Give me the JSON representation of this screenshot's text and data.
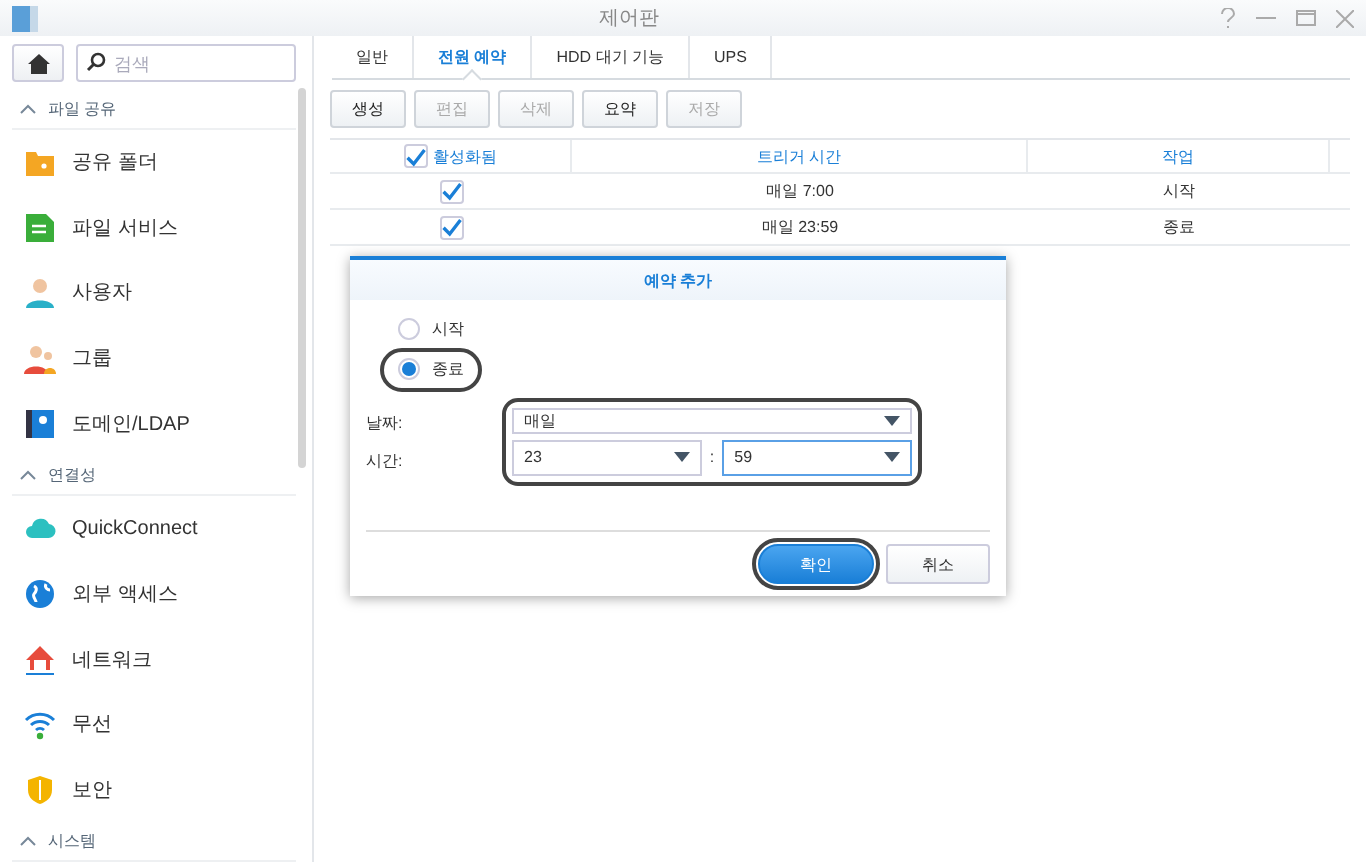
{
  "window": {
    "title": "제어판"
  },
  "search": {
    "placeholder": "검색"
  },
  "sidebar": {
    "sections": [
      {
        "title": "파일 공유",
        "expanded": true,
        "items": [
          {
            "label": "공유 폴더",
            "kind": "folder"
          },
          {
            "label": "파일 서비스",
            "kind": "fileservice"
          },
          {
            "label": "사용자",
            "kind": "user"
          },
          {
            "label": "그룹",
            "kind": "group"
          },
          {
            "label": "도메인/LDAP",
            "kind": "domain"
          }
        ]
      },
      {
        "title": "연결성",
        "expanded": true,
        "items": [
          {
            "label": "QuickConnect",
            "kind": "cloud"
          },
          {
            "label": "외부 액세스",
            "kind": "globe"
          },
          {
            "label": "네트워크",
            "kind": "network"
          },
          {
            "label": "무선",
            "kind": "wifi"
          },
          {
            "label": "보안",
            "kind": "shield"
          }
        ]
      },
      {
        "title": "시스템",
        "expanded": true
      }
    ]
  },
  "tabs": [
    {
      "label": "일반",
      "selected": false
    },
    {
      "label": "전원 예약",
      "selected": true
    },
    {
      "label": "HDD 대기 기능",
      "selected": false
    },
    {
      "label": "UPS",
      "selected": false
    }
  ],
  "toolbar": [
    {
      "label": "생성",
      "disabled": false
    },
    {
      "label": "편집",
      "disabled": true
    },
    {
      "label": "삭제",
      "disabled": true
    },
    {
      "label": "요약",
      "disabled": false
    },
    {
      "label": "저장",
      "disabled": true
    }
  ],
  "table": {
    "columns": [
      {
        "label": "활성화됨",
        "checked": true
      },
      {
        "label": "트리거 시간"
      },
      {
        "label": "작업"
      }
    ],
    "rows": [
      {
        "enabled": true,
        "time": "매일 7:00",
        "action": "시작"
      },
      {
        "enabled": true,
        "time": "매일 23:59",
        "action": "종료"
      }
    ]
  },
  "dialog": {
    "title": "예약 추가",
    "options": [
      {
        "label": "시작",
        "selected": false,
        "highlighted": false
      },
      {
        "label": "종료",
        "selected": true,
        "highlighted": true
      }
    ],
    "date_label": "날짜:",
    "date_value": "매일",
    "time_label": "시간:",
    "hour": "23",
    "separator": ":",
    "minute": "59",
    "fields_highlighted": true,
    "buttons": [
      {
        "label": "확인",
        "kind": "primary",
        "highlighted": true
      },
      {
        "label": "취소",
        "kind": "secondary",
        "highlighted": false
      }
    ]
  }
}
